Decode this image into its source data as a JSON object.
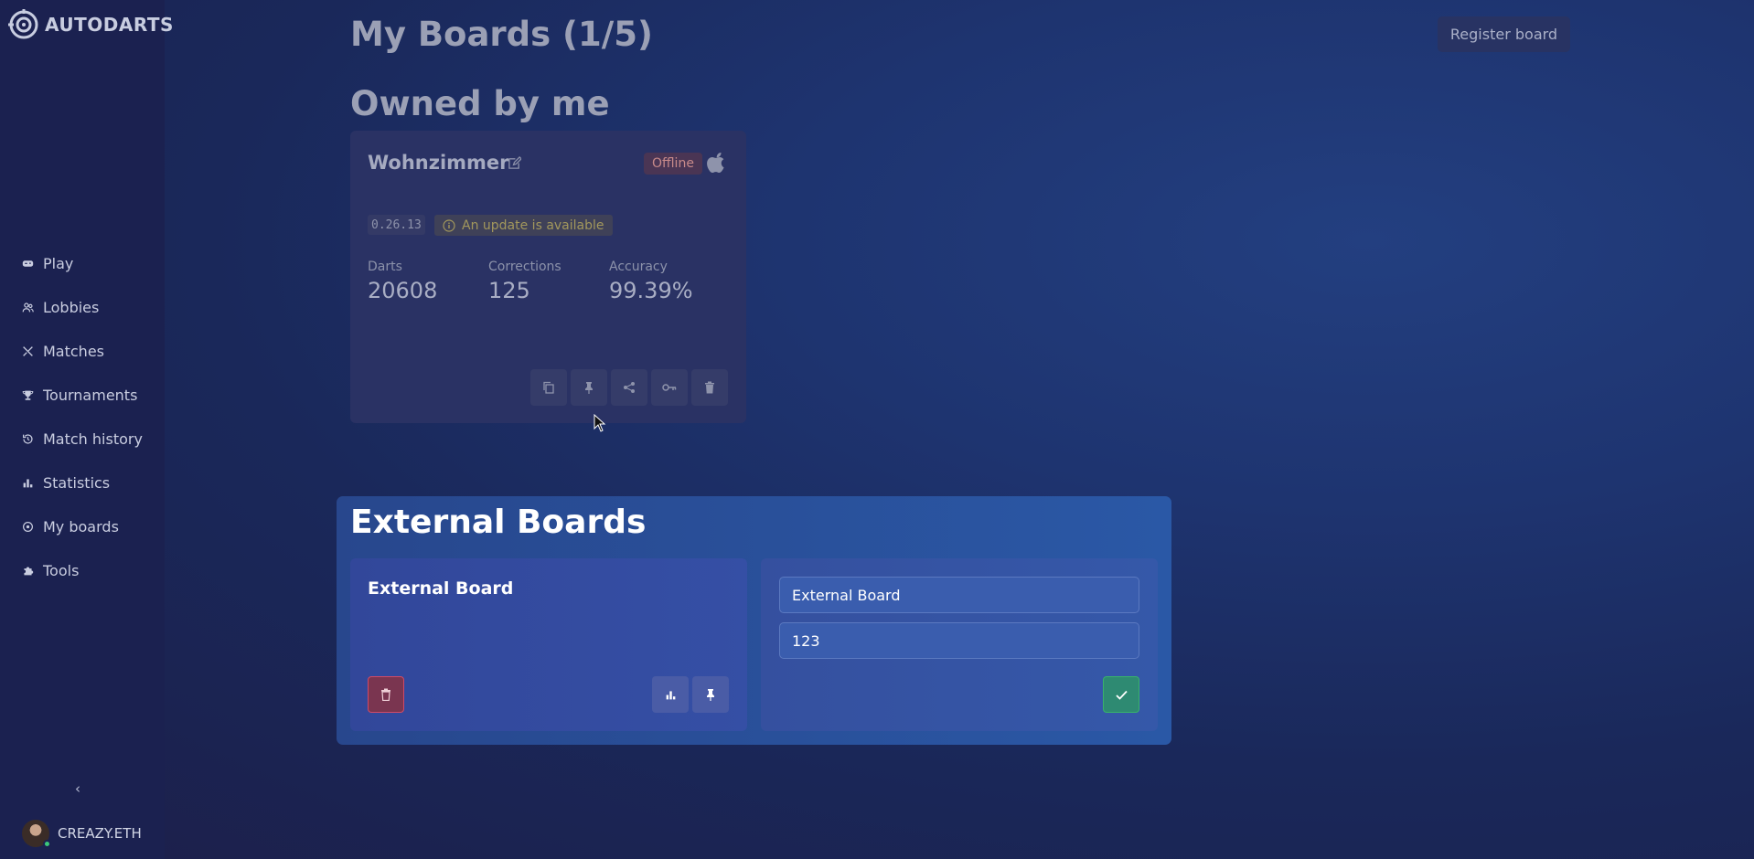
{
  "app": {
    "logo_text": "AUTODARTS"
  },
  "sidebar": {
    "items": [
      {
        "label": "Play",
        "icon": "gamepad-icon"
      },
      {
        "label": "Lobbies",
        "icon": "users-icon"
      },
      {
        "label": "Matches",
        "icon": "swords-icon"
      },
      {
        "label": "Tournaments",
        "icon": "trophy-icon"
      },
      {
        "label": "Match history",
        "icon": "history-icon"
      },
      {
        "label": "Statistics",
        "icon": "bar-chart-icon"
      },
      {
        "label": "My boards",
        "icon": "target-icon"
      },
      {
        "label": "Tools",
        "icon": "puzzle-icon"
      }
    ],
    "collapse_label": "‹",
    "user": {
      "name": "CREAZY.ETH",
      "status": "online"
    }
  },
  "header": {
    "title": "My Boards (1/5)",
    "register_label": "Register board"
  },
  "owned": {
    "title": "Owned by me",
    "board": {
      "name": "Wohnzimmer",
      "status": "Offline",
      "platform_icon": "apple-icon",
      "version": "0.26.13",
      "update_text": "An update is available",
      "stats": [
        {
          "label": "Darts",
          "value": "20608"
        },
        {
          "label": "Corrections",
          "value": "125"
        },
        {
          "label": "Accuracy",
          "value": "99.39%"
        }
      ]
    }
  },
  "external": {
    "title": "External Boards",
    "board_name": "External Board",
    "form": {
      "name_value": "External Board",
      "id_value": "123"
    }
  },
  "colors": {
    "accent_blue": "#2a58a6",
    "danger": "#d04a66",
    "success": "#38b26a",
    "sidebar_bg": "#1b2150"
  }
}
